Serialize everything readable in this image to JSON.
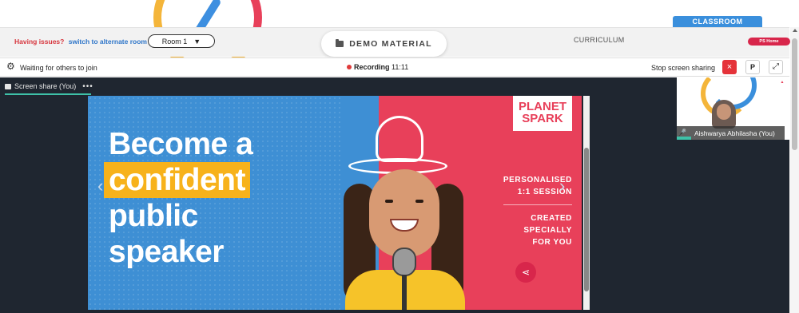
{
  "header": {
    "issue_text": "Having issues?",
    "issue_link": "switch to alternate room",
    "room_select": "Room 1",
    "demo_material": "DEMO MATERIAL",
    "curriculum": "CURRICULUM",
    "classroom": "CLASSROOM",
    "ps_badge": "PS Home"
  },
  "meeting_bar": {
    "waiting_text": "Waiting for others to join",
    "recording_label": "Recording",
    "recording_time": "11:11",
    "stop_share_label": "Stop screen sharing",
    "stop_icon": "×",
    "p_button": "P"
  },
  "screen_share": {
    "label": "Screen share (You)",
    "menu": "•••"
  },
  "slide": {
    "heading_line1": "Become a",
    "heading_line2": "confident",
    "heading_line3": "public",
    "heading_line4": "speaker",
    "logo_line1": "PLANET",
    "logo_line2": "SPARK",
    "tag1_line1": "PERSONALISED",
    "tag1_line2": "1:1 SESSION",
    "tag2_line1": "CREATED SPECIALLY",
    "tag2_line2": "FOR YOU",
    "accent_blue": "#3e8fd4",
    "accent_pink": "#e8405a",
    "accent_yellow": "#f7b21b"
  },
  "pip": {
    "name": "Aishwarya Abhilasha (You)"
  }
}
